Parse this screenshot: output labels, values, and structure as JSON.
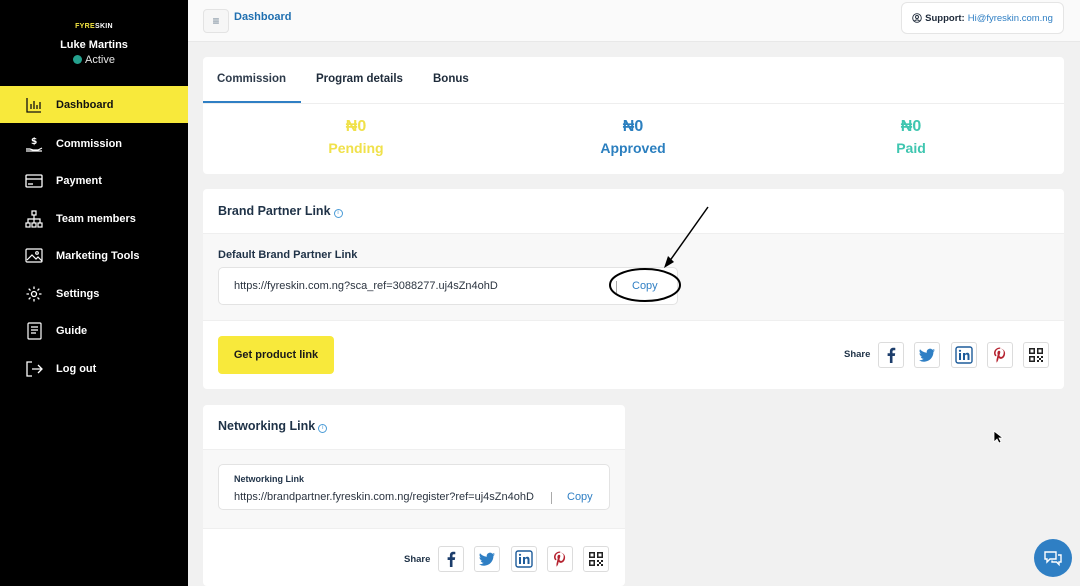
{
  "sidebar": {
    "logo": {
      "part1": "FYRE",
      "part2": "SKIN"
    },
    "user_name": "Luke Martins",
    "user_status": "Active",
    "items": [
      {
        "label": "Dashboard",
        "icon": "chart-icon",
        "active": true
      },
      {
        "label": "Commission",
        "icon": "hand-dollar-icon"
      },
      {
        "label": "Payment",
        "icon": "card-icon"
      },
      {
        "label": "Team members",
        "icon": "hierarchy-icon"
      },
      {
        "label": "Marketing Tools",
        "icon": "image-icon"
      },
      {
        "label": "Settings",
        "icon": "gear-icon"
      },
      {
        "label": "Guide",
        "icon": "book-icon"
      },
      {
        "label": "Log out",
        "icon": "logout-icon"
      }
    ]
  },
  "topbar": {
    "title": "Dashboard",
    "support_label": "Support:",
    "support_email": "Hi@fyreskin.com.ng"
  },
  "tabs": [
    {
      "label": "Commission",
      "active": true
    },
    {
      "label": "Program details"
    },
    {
      "label": "Bonus"
    }
  ],
  "stats": [
    {
      "amount": "₦0",
      "label": "Pending",
      "color": "#f0e14a"
    },
    {
      "amount": "₦0",
      "label": "Approved",
      "color": "#2b7fbf"
    },
    {
      "amount": "₦0",
      "label": "Paid",
      "color": "#3fc6b0"
    }
  ],
  "brand_partner": {
    "title": "Brand Partner Link",
    "sublabel": "Default Brand Partner Link",
    "url": "https://fyreskin.com.ng?sca_ref=3088277.uj4sZn4ohD",
    "copy_label": "Copy",
    "get_product_label": "Get product link",
    "share_label": "Share"
  },
  "networking": {
    "title": "Networking Link",
    "box_label": "Networking Link",
    "url": "https://brandpartner.fyreskin.com.ng/register?ref=uj4sZn4ohD",
    "copy_label": "Copy",
    "share_label": "Share"
  },
  "colors": {
    "accent_yellow": "#f8e93b",
    "link_blue": "#2f7fc4",
    "sidebar_bg": "#000000"
  }
}
